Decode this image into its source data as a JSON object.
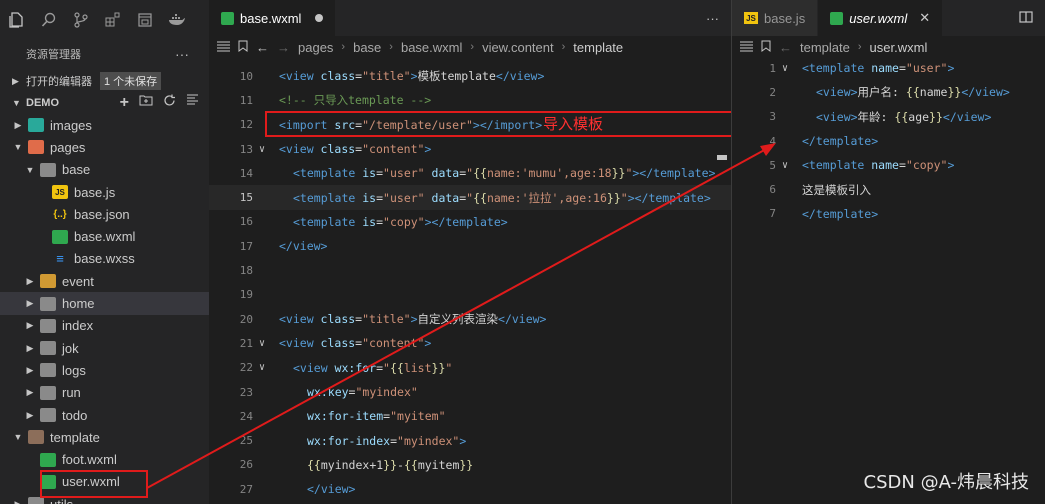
{
  "sidebar": {
    "activity_icons": [
      "files-icon",
      "search-icon",
      "source-control-icon",
      "extensions-icon",
      "remote-icon",
      "docker-icon"
    ],
    "explorer_title": "资源管理器",
    "explorer_more": "···",
    "open_editors": {
      "label": "打开的编辑器",
      "badge": "1 个未保存"
    },
    "workspace": "DEMO",
    "tree": [
      {
        "label": "images",
        "depth": 1,
        "kind": "folder-images",
        "expanded": false
      },
      {
        "label": "pages",
        "depth": 1,
        "kind": "folder-pages",
        "expanded": true
      },
      {
        "label": "base",
        "depth": 2,
        "kind": "folder",
        "expanded": true
      },
      {
        "label": "base.js",
        "depth": 3,
        "kind": "js"
      },
      {
        "label": "base.json",
        "depth": 3,
        "kind": "json"
      },
      {
        "label": "base.wxml",
        "depth": 3,
        "kind": "wxml"
      },
      {
        "label": "base.wxss",
        "depth": 3,
        "kind": "wxss"
      },
      {
        "label": "event",
        "depth": 2,
        "kind": "folder-event",
        "expanded": false
      },
      {
        "label": "home",
        "depth": 2,
        "kind": "folder",
        "expanded": false,
        "selected": true
      },
      {
        "label": "index",
        "depth": 2,
        "kind": "folder",
        "expanded": false
      },
      {
        "label": "jok",
        "depth": 2,
        "kind": "folder",
        "expanded": false
      },
      {
        "label": "logs",
        "depth": 2,
        "kind": "folder",
        "expanded": false
      },
      {
        "label": "run",
        "depth": 2,
        "kind": "folder",
        "expanded": false
      },
      {
        "label": "todo",
        "depth": 2,
        "kind": "folder",
        "expanded": false
      },
      {
        "label": "template",
        "depth": 1,
        "kind": "folder-template",
        "expanded": true
      },
      {
        "label": "foot.wxml",
        "depth": 2,
        "kind": "wxml"
      },
      {
        "label": "user.wxml",
        "depth": 2,
        "kind": "wxml",
        "boxed": true
      },
      {
        "label": "utils",
        "depth": 1,
        "kind": "folder",
        "expanded": false
      }
    ]
  },
  "editor1": {
    "tab": {
      "label": "base.wxml",
      "modified": true
    },
    "more": "···",
    "breadcrumb": [
      "pages",
      "base",
      "base.wxml",
      "view.content",
      "template"
    ],
    "lines": [
      {
        "n": "10",
        "fold": "",
        "indent": 0,
        "parts": [
          [
            "t-tag",
            "<view "
          ],
          [
            "t-attr",
            "class"
          ],
          [
            "t-txt",
            "="
          ],
          [
            "t-str",
            "\"title\""
          ],
          [
            "t-tag",
            ">"
          ],
          [
            "t-txt",
            "模板template"
          ],
          [
            "t-tag",
            "</view>"
          ]
        ]
      },
      {
        "n": "11",
        "fold": "",
        "indent": 0,
        "parts": [
          [
            "t-com",
            "<!-- 只导入template -->"
          ]
        ]
      },
      {
        "n": "12",
        "fold": "",
        "indent": 0,
        "parts": [
          [
            "t-tag",
            "<import "
          ],
          [
            "t-attr",
            "src"
          ],
          [
            "t-txt",
            "="
          ],
          [
            "t-str",
            "\"/template/user\""
          ],
          [
            "t-tag",
            "></import>"
          ]
        ]
      },
      {
        "n": "13",
        "fold": "v",
        "indent": 0,
        "parts": [
          [
            "t-tag",
            "<view "
          ],
          [
            "t-attr",
            "class"
          ],
          [
            "t-txt",
            "="
          ],
          [
            "t-str",
            "\"content\""
          ],
          [
            "t-tag",
            ">"
          ]
        ]
      },
      {
        "n": "14",
        "fold": "",
        "indent": 1,
        "parts": [
          [
            "t-tag",
            "<template "
          ],
          [
            "t-attr",
            "is"
          ],
          [
            "t-txt",
            "="
          ],
          [
            "t-str",
            "\"user\" "
          ],
          [
            "t-attr",
            "data"
          ],
          [
            "t-txt",
            "="
          ],
          [
            "t-str",
            "\""
          ],
          [
            "t-br",
            "{{"
          ],
          [
            "t-str",
            "name:'mumu',age:18"
          ],
          [
            "t-br",
            "}}"
          ],
          [
            "t-str",
            "\""
          ],
          [
            "t-tag",
            "></template>"
          ]
        ]
      },
      {
        "n": "15",
        "fold": "",
        "indent": 1,
        "current": true,
        "parts": [
          [
            "t-tag",
            "<template "
          ],
          [
            "t-attr",
            "is"
          ],
          [
            "t-txt",
            "="
          ],
          [
            "t-str",
            "\"user\" "
          ],
          [
            "t-attr",
            "data"
          ],
          [
            "t-txt",
            "="
          ],
          [
            "t-str",
            "\""
          ],
          [
            "t-br",
            "{{"
          ],
          [
            "t-str",
            "name:'拉拉',age:16"
          ],
          [
            "t-br",
            "}}"
          ],
          [
            "t-str",
            "\""
          ],
          [
            "t-tag",
            "></template>"
          ]
        ]
      },
      {
        "n": "16",
        "fold": "",
        "indent": 1,
        "parts": [
          [
            "t-tag",
            "<template "
          ],
          [
            "t-attr",
            "is"
          ],
          [
            "t-txt",
            "="
          ],
          [
            "t-str",
            "\"copy\""
          ],
          [
            "t-tag",
            "></template>"
          ]
        ]
      },
      {
        "n": "17",
        "fold": "",
        "indent": 0,
        "parts": [
          [
            "t-tag",
            "</view>"
          ]
        ]
      },
      {
        "n": "18",
        "fold": "",
        "indent": 0,
        "parts": []
      },
      {
        "n": "19",
        "fold": "",
        "indent": 0,
        "parts": []
      },
      {
        "n": "20",
        "fold": "",
        "indent": 0,
        "parts": [
          [
            "t-tag",
            "<view "
          ],
          [
            "t-attr",
            "class"
          ],
          [
            "t-txt",
            "="
          ],
          [
            "t-str",
            "\"title\""
          ],
          [
            "t-tag",
            ">"
          ],
          [
            "t-txt",
            "自定义列表渲染"
          ],
          [
            "t-tag",
            "</view>"
          ]
        ]
      },
      {
        "n": "21",
        "fold": "v",
        "indent": 0,
        "parts": [
          [
            "t-tag",
            "<view "
          ],
          [
            "t-attr",
            "class"
          ],
          [
            "t-txt",
            "="
          ],
          [
            "t-str",
            "\"content\""
          ],
          [
            "t-tag",
            ">"
          ]
        ]
      },
      {
        "n": "22",
        "fold": "v",
        "indent": 1,
        "parts": [
          [
            "t-tag",
            "<view "
          ],
          [
            "t-attr",
            "wx:for"
          ],
          [
            "t-txt",
            "="
          ],
          [
            "t-str",
            "\""
          ],
          [
            "t-br",
            "{{"
          ],
          [
            "t-str",
            "list"
          ],
          [
            "t-br",
            "}}"
          ],
          [
            "t-str",
            "\""
          ]
        ]
      },
      {
        "n": "23",
        "fold": "",
        "indent": 2,
        "parts": [
          [
            "t-attr",
            "wx:key"
          ],
          [
            "t-txt",
            "="
          ],
          [
            "t-str",
            "\"myindex\""
          ]
        ]
      },
      {
        "n": "24",
        "fold": "",
        "indent": 2,
        "parts": [
          [
            "t-attr",
            "wx:for-item"
          ],
          [
            "t-txt",
            "="
          ],
          [
            "t-str",
            "\"myitem\""
          ]
        ]
      },
      {
        "n": "25",
        "fold": "",
        "indent": 2,
        "parts": [
          [
            "t-attr",
            "wx:for-index"
          ],
          [
            "t-txt",
            "="
          ],
          [
            "t-str",
            "\"myindex\""
          ],
          [
            "t-tag",
            ">"
          ]
        ]
      },
      {
        "n": "26",
        "fold": "",
        "indent": 2,
        "parts": [
          [
            "t-br",
            "{{"
          ],
          [
            "t-txt",
            "myindex+1"
          ],
          [
            "t-br",
            "}}"
          ],
          [
            "t-txt",
            "-"
          ],
          [
            "t-br",
            "{{"
          ],
          [
            "t-txt",
            "myitem"
          ],
          [
            "t-br",
            "}}"
          ]
        ]
      },
      {
        "n": "27",
        "fold": "",
        "indent": 2,
        "parts": [
          [
            "t-tag",
            "</view>"
          ]
        ]
      }
    ],
    "annotation": "导入模板"
  },
  "editor2": {
    "tabs": [
      {
        "label": "base.js",
        "kind": "js",
        "active": false
      },
      {
        "label": "user.wxml",
        "kind": "wxml",
        "active": true
      }
    ],
    "breadcrumb": [
      "template",
      "user.wxml"
    ],
    "lines": [
      {
        "n": "1",
        "fold": "v",
        "indent": 0,
        "parts": [
          [
            "t-tag",
            "<template "
          ],
          [
            "t-attr",
            "name"
          ],
          [
            "t-txt",
            "="
          ],
          [
            "t-str",
            "\"user\""
          ],
          [
            "t-tag",
            ">"
          ]
        ]
      },
      {
        "n": "2",
        "fold": "",
        "indent": 1,
        "parts": [
          [
            "t-tag",
            "<view>"
          ],
          [
            "t-txt",
            "用户名: "
          ],
          [
            "t-br",
            "{{"
          ],
          [
            "t-txt",
            "name"
          ],
          [
            "t-br",
            "}}"
          ],
          [
            "t-tag",
            "</view>"
          ]
        ]
      },
      {
        "n": "3",
        "fold": "",
        "indent": 1,
        "parts": [
          [
            "t-tag",
            "<view>"
          ],
          [
            "t-txt",
            "年龄: "
          ],
          [
            "t-br",
            "{{"
          ],
          [
            "t-txt",
            "age"
          ],
          [
            "t-br",
            "}}"
          ],
          [
            "t-tag",
            "</view>"
          ]
        ]
      },
      {
        "n": "4",
        "fold": "",
        "indent": 0,
        "parts": [
          [
            "t-tag",
            "</template>"
          ]
        ]
      },
      {
        "n": "5",
        "fold": "v",
        "indent": 0,
        "parts": [
          [
            "t-tag",
            "<template "
          ],
          [
            "t-attr",
            "name"
          ],
          [
            "t-txt",
            "="
          ],
          [
            "t-str",
            "\"copy\""
          ],
          [
            "t-tag",
            ">"
          ]
        ]
      },
      {
        "n": "6",
        "fold": "",
        "indent": 0,
        "parts": [
          [
            "t-txt",
            "这是模板引入"
          ]
        ]
      },
      {
        "n": "7",
        "fold": "",
        "indent": 0,
        "parts": [
          [
            "t-tag",
            "</template>"
          ]
        ]
      }
    ]
  },
  "watermark": "CSDN @A-炜晨科技",
  "colors": {
    "annotation": "#e01b1b",
    "accent": "#007acc"
  }
}
